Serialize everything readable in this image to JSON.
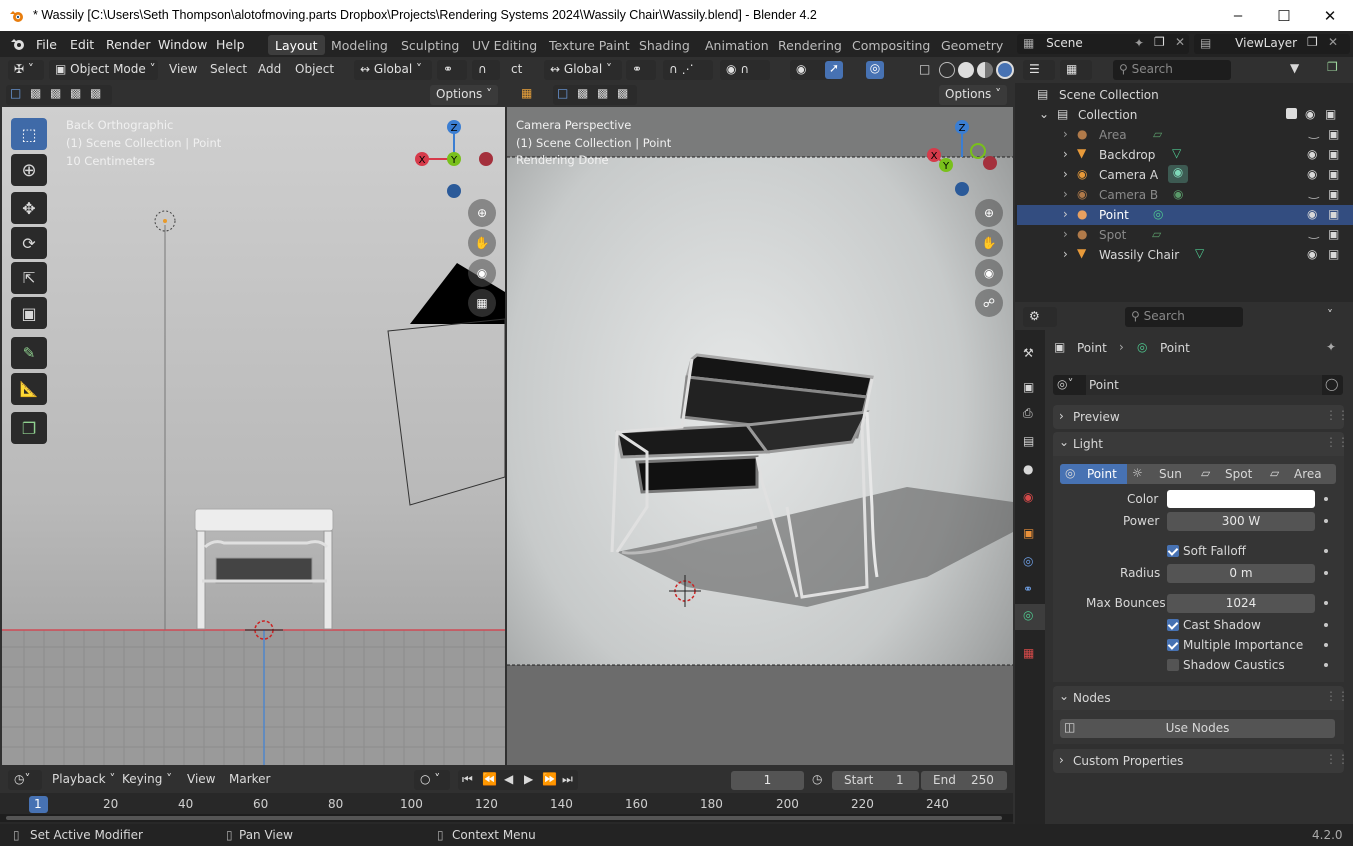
{
  "window": {
    "title": "* Wassily [C:\\Users\\Seth Thompson\\alotofmoving.parts Dropbox\\Projects\\Rendering Systems 2024\\Wassily Chair\\Wassily.blend] - Blender 4.2"
  },
  "menu": [
    "File",
    "Edit",
    "Render",
    "Window",
    "Help"
  ],
  "workspaces": [
    "Layout",
    "Modeling",
    "Sculpting",
    "UV Editing",
    "Texture Paint",
    "Shading",
    "Animation",
    "Rendering",
    "Compositing",
    "Geometry No"
  ],
  "scene": {
    "label": "Scene",
    "view_layer": "ViewLayer"
  },
  "viewport_left": {
    "mode": "Object Mode",
    "menus": [
      "View",
      "Select",
      "Add",
      "Object"
    ],
    "orientation": "Global",
    "options": "Options",
    "overlay_lines": [
      "Back Orthographic",
      "(1) Scene Collection | Point",
      "10 Centimeters"
    ],
    "gizmo": {
      "z": "Z",
      "y": "Y",
      "x": "X"
    }
  },
  "viewport_right": {
    "orientation": "Global",
    "truncated": "ct",
    "options": "Options",
    "overlay_lines": [
      "Camera Perspective",
      "(1) Scene Collection | Point",
      "Rendering Done"
    ],
    "gizmo": {
      "z": "Z",
      "y": "Y",
      "x": "X"
    }
  },
  "outliner": {
    "search_placeholder": "Search",
    "root": "Scene Collection",
    "collection": "Collection",
    "items": [
      {
        "name": "Area",
        "visible": false
      },
      {
        "name": "Backdrop",
        "visible": true
      },
      {
        "name": "Camera A",
        "visible": true
      },
      {
        "name": "Camera B",
        "visible": false
      },
      {
        "name": "Point",
        "visible": true,
        "selected": true
      },
      {
        "name": "Spot",
        "visible": false
      },
      {
        "name": "Wassily Chair",
        "visible": true
      }
    ]
  },
  "properties": {
    "search_placeholder": "Search",
    "breadcrumb": [
      "Point",
      "Point"
    ],
    "datablock": "Point",
    "panels": {
      "preview": "Preview",
      "light": "Light",
      "nodes": "Nodes",
      "custom": "Custom Properties"
    },
    "light_types": [
      "Point",
      "Sun",
      "Spot",
      "Area"
    ],
    "active_light_type": "Point",
    "color_label": "Color",
    "color_value": "#ffffff",
    "power_label": "Power",
    "power_value": "300 W",
    "soft_falloff": "Soft Falloff",
    "radius_label": "Radius",
    "radius_value": "0 m",
    "max_bounces_label": "Max Bounces",
    "max_bounces_value": "1024",
    "cast_shadow": "Cast Shadow",
    "multiple_importance": "Multiple Importance",
    "shadow_caustics": "Shadow Caustics",
    "checks": {
      "soft_falloff": true,
      "cast_shadow": true,
      "multiple_importance": true,
      "shadow_caustics": false
    },
    "use_nodes": "Use Nodes"
  },
  "timeline": {
    "menus": [
      "Playback",
      "Keying",
      "View",
      "Marker"
    ],
    "current_frame": "1",
    "start_label": "Start",
    "start_value": "1",
    "end_label": "End",
    "end_value": "250",
    "ticks": [
      "1",
      "20",
      "40",
      "60",
      "80",
      "100",
      "120",
      "140",
      "160",
      "180",
      "200",
      "220",
      "240"
    ]
  },
  "statusbar": {
    "items": [
      "Set Active Modifier",
      "Pan View",
      "Context Menu"
    ],
    "version": "4.2.0"
  },
  "colors": {
    "accent": "#4772b3",
    "selection": "#334d80",
    "x_axis": "#d63a4a",
    "y_axis": "#79c01b",
    "z_axis": "#3b7ed2"
  }
}
